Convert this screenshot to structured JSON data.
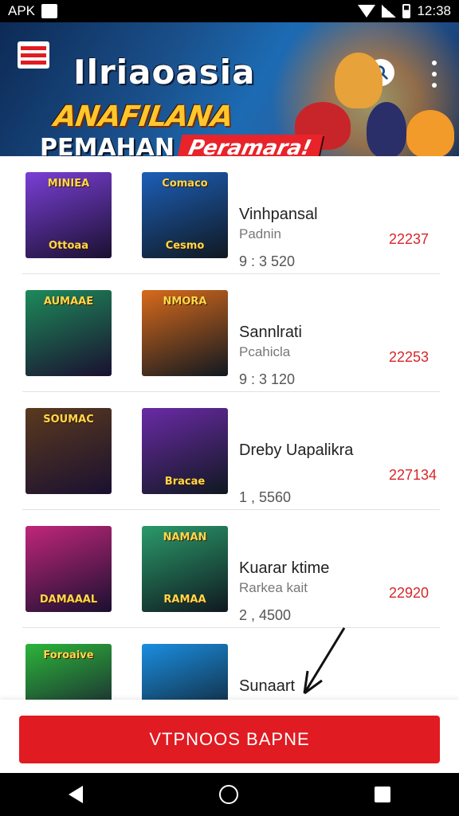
{
  "status_bar": {
    "carrier": "APK",
    "time": "12:38"
  },
  "header": {
    "title": "Ilriaoasia",
    "slogan_line1": "ANAFILANA",
    "slogan_line2a": "PEMAHAN",
    "slogan_line2b": "Peramara!"
  },
  "list": [
    {
      "thumb_a_top": "MINIEA",
      "thumb_a_bottom": "Ottoaa",
      "thumb_b_top": "Comaco",
      "thumb_b_bottom": "Cesmo",
      "title": "Vinhpansal",
      "subtitle": "Padnin",
      "meta": "9 : 3 520",
      "price": "22237",
      "colors": [
        "#7a3fd6",
        "#1c5fb8"
      ]
    },
    {
      "thumb_a_top": "AUMAAE",
      "thumb_a_bottom": "",
      "thumb_b_top": "NMORA",
      "thumb_b_bottom": "",
      "title": "Sannlrati",
      "subtitle": "Pcahicla",
      "meta": "9 : 3 120",
      "price": "22253",
      "colors": [
        "#1d8a5a",
        "#d86a1c"
      ]
    },
    {
      "thumb_a_top": "SOUMAC",
      "thumb_a_bottom": "",
      "thumb_b_top": "",
      "thumb_b_bottom": "Bracae",
      "title": "Dreby Uapalikra",
      "subtitle": "",
      "meta": "1 , 5560",
      "price": "227134",
      "colors": [
        "#5a3a1e",
        "#6a2aa6"
      ]
    },
    {
      "thumb_a_top": "",
      "thumb_a_bottom": "DAMAAAL",
      "thumb_b_top": "NAMAN",
      "thumb_b_bottom": "RAMAA",
      "title": "Kuarar ktime",
      "subtitle": "Rarkea kait",
      "meta": "2 , 4500",
      "price": "22920",
      "colors": [
        "#c0267a",
        "#2a9a6a"
      ]
    },
    {
      "thumb_a_top": "Foroaive",
      "thumb_a_bottom": "",
      "thumb_b_top": "",
      "thumb_b_bottom": "",
      "title": "Sunaart",
      "subtitle": "",
      "meta": "",
      "price": "",
      "colors": [
        "#2bb53a",
        "#1a8ee0"
      ]
    }
  ],
  "action": {
    "button_label": "VTPNOOS BAPNE"
  },
  "colors": {
    "accent": "#e01b22",
    "price": "#d7262b",
    "banner": "#1a4f8a"
  },
  "icons": [
    "apk-icon",
    "wifi-icon",
    "signal-icon",
    "battery-icon",
    "brand-logo-icon",
    "search-icon",
    "more-vert-icon",
    "back-icon",
    "home-icon",
    "recents-icon",
    "arrow-annotation-icon"
  ]
}
